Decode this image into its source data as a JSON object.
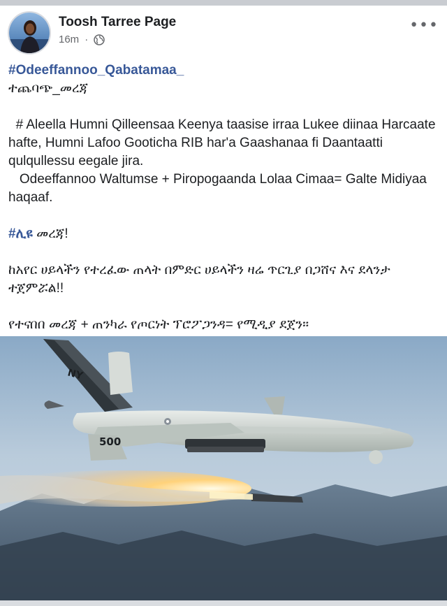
{
  "post": {
    "page_name": "Toosh Tarree Page",
    "timestamp": "16m",
    "separator": "·",
    "audience_icon": "globe-icon",
    "more_icon": "more-options-icon",
    "hashtag_main": "#Odeeffannoo_Qabatamaa_",
    "line_tag": "ተጨባጭ_መረጃ",
    "para1": "  # Aleella Humni Qilleensaa Keenya taasise irraa Lukee diinaa Harcaate hafte, Humni Lafoo Gooticha RIB har'a Gaashanaa fi Daantaatti qulqullessu eegale jira.",
    "para2": "   Odeeffannoo Waltumse + Piropogaanda Lolaa Cimaa= Galte Midiyaa haqaaf.",
    "hashtag_amharic": "#ሊዩ",
    "hashtag_amharic_rest": " መረጃ!",
    "para3": "ከአየር ሀይላችን የተረፈው ጠላት በምድር ሀይላችን ዛሬ ጥርጊያ በጋሸና እና ደላንታ ተጀምሯል!!",
    "para4": "የተናበበ መረጃ + ጠንካራ የጦርነት ፕሮፖጋንዳ= የሚዲያ ደጀን።"
  },
  "photo": {
    "drone_marking": "NY",
    "tail_number": "500"
  },
  "colors": {
    "hashtag": "#385898",
    "text": "#1c1e21",
    "meta": "#65676b"
  }
}
